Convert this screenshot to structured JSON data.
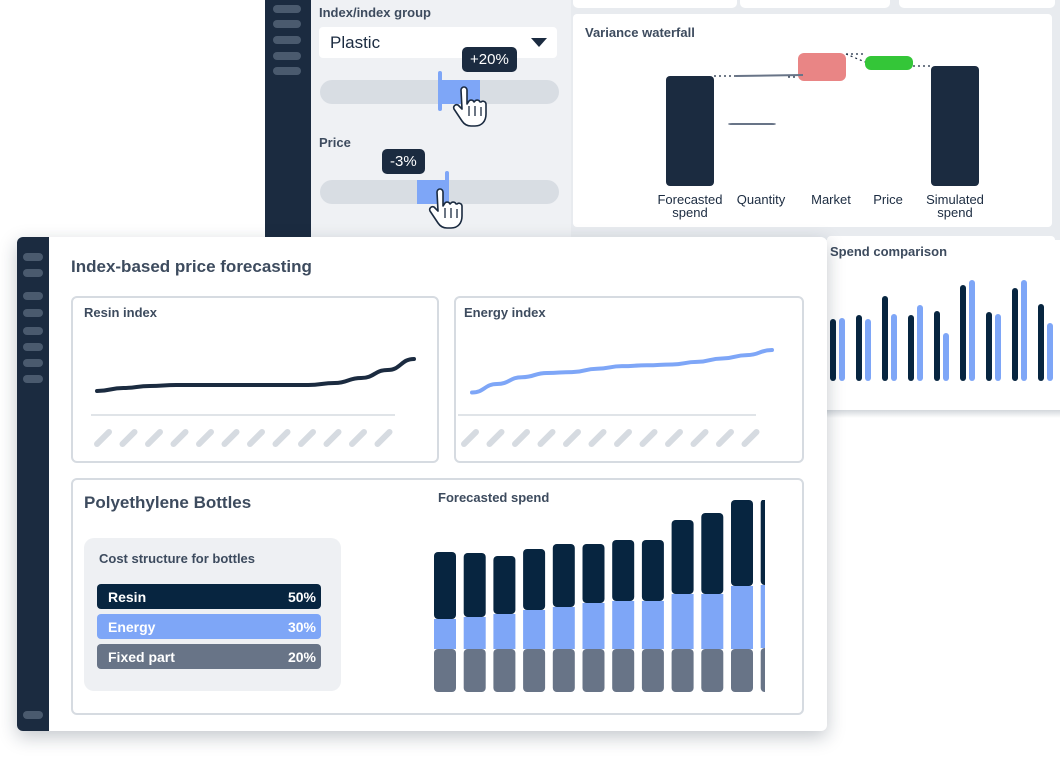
{
  "colors": {
    "navy": "#1b2b40",
    "dark": "#072540",
    "blue": "#7ea6f7",
    "grey": "#687487",
    "red": "#e98585",
    "green": "#34c638",
    "panel": "#eff1f4",
    "border": "#d6dbe1"
  },
  "controls": {
    "index_group_label": "Index/index group",
    "index_group_value": "Plastic",
    "index_slider_tooltip": "+20%",
    "price_label": "Price",
    "price_slider_tooltip": "-3%",
    "index_slider_level": 0.5,
    "price_slider_level": 0.53
  },
  "waterfall": {
    "title": "Variance waterfall",
    "chart_data": {
      "type": "bar",
      "categories": [
        "Forecasted\nspend",
        "Quantity",
        "Market",
        "Price",
        "Simulated\nspend"
      ],
      "values": [
        110,
        0,
        25,
        -15,
        120
      ],
      "title": "Variance waterfall",
      "xlabel": "",
      "ylabel": ""
    }
  },
  "spend_comparison": {
    "title": "Spend comparison",
    "chart_data": {
      "type": "bar",
      "series": [
        {
          "values": [
            62,
            66,
            85,
            66,
            70,
            96,
            69,
            93,
            77
          ]
        },
        {
          "values": [
            63,
            62,
            67,
            76,
            48,
            101,
            67,
            101,
            58
          ]
        }
      ]
    }
  },
  "main": {
    "title": "Index-based price forecasting",
    "resin_index": {
      "title": "Resin index",
      "chart_data": {
        "type": "line",
        "x": [
          0,
          1,
          2,
          3,
          4,
          5,
          6,
          7,
          8,
          9,
          10,
          11,
          12
        ],
        "values": [
          10,
          13,
          15,
          16,
          16,
          16,
          16,
          16,
          16,
          18,
          23,
          31,
          42
        ]
      }
    },
    "energy_index": {
      "title": "Energy index",
      "chart_data": {
        "type": "line",
        "x": [
          0,
          1,
          2,
          3,
          4,
          5,
          6,
          7,
          8,
          9,
          10,
          11,
          12
        ],
        "values": [
          10,
          20,
          28,
          33,
          34,
          38,
          41,
          42,
          43,
          46,
          50,
          54,
          60
        ]
      }
    },
    "product_title": "Polyethylene Bottles",
    "cost_structure": {
      "title": "Cost structure for bottles",
      "rows": [
        {
          "label": "Resin",
          "pct": "50%"
        },
        {
          "label": "Energy",
          "pct": "30%"
        },
        {
          "label": "Fixed part",
          "pct": "20%"
        }
      ]
    },
    "forecasted_spend": {
      "title": "Forecasted spend",
      "chart_data": {
        "type": "bar",
        "stacked": true,
        "series": [
          {
            "name": "Resin",
            "values": [
              67,
              64,
              58,
              61,
              63,
              59,
              61,
              61,
              74,
              81,
              86,
              86
            ]
          },
          {
            "name": "Energy",
            "values": [
              30,
              32,
              35,
              39,
              42,
              46,
              48,
              48,
              55,
              55,
              63,
              63
            ]
          },
          {
            "name": "Fixed part",
            "values": [
              43,
              43,
              43,
              43,
              43,
              43,
              43,
              43,
              43,
              43,
              43,
              44
            ]
          }
        ]
      }
    }
  }
}
